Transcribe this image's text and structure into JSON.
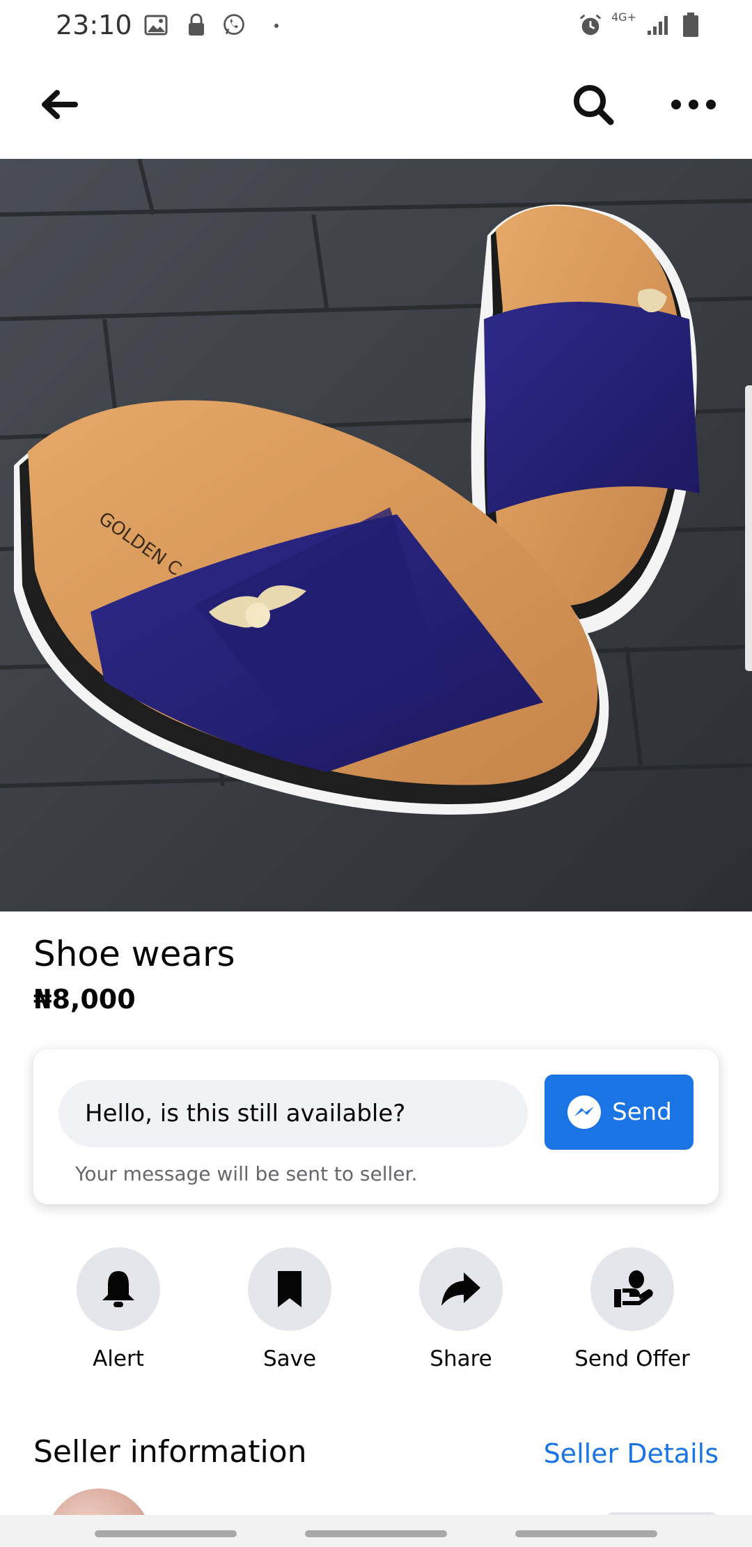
{
  "status_bar": {
    "time": "23:10",
    "network_label": "4G+",
    "icons": [
      "image-icon",
      "lock-icon",
      "whatsapp-icon",
      "alarm-icon",
      "signal-icon",
      "battery-icon"
    ]
  },
  "nav": {
    "back_icon": "arrow-left-icon",
    "search_icon": "search-icon",
    "more_icon": "more-horizontal-icon"
  },
  "listing": {
    "title": "Shoe wears",
    "price": "₦8,000",
    "image_description_icon": "product-photo"
  },
  "message": {
    "input_value": "Hello, is this still available?",
    "send_label": "Send",
    "note": "Your message will be sent to seller."
  },
  "actions": [
    {
      "label": "Alert",
      "icon": "bell-icon"
    },
    {
      "label": "Save",
      "icon": "bookmark-icon"
    },
    {
      "label": "Share",
      "icon": "share-icon"
    },
    {
      "label": "Send Offer",
      "icon": "offer-icon"
    }
  ],
  "seller": {
    "section_title": "Seller information",
    "details_link": "Seller Details"
  },
  "colors": {
    "accent": "#1b74e4",
    "chip_bg": "#e4e6eb",
    "input_bg": "#f0f2f5",
    "muted_text": "#65676b"
  }
}
